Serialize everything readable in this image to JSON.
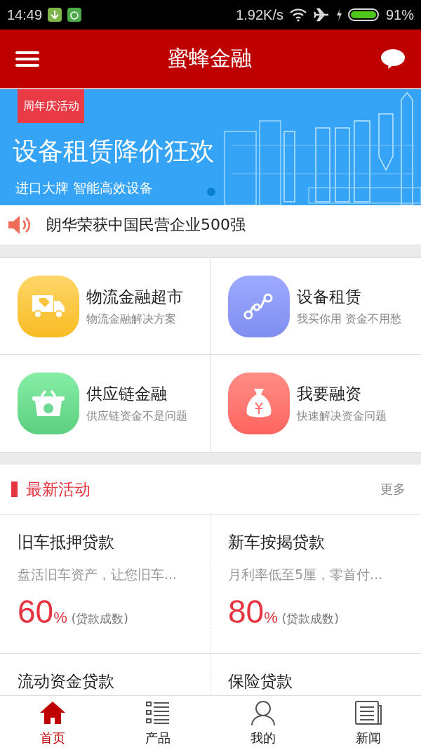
{
  "status_bar": {
    "time": "14:49",
    "speed": "1.92K/s",
    "battery": "91%"
  },
  "header": {
    "title": "蜜蜂金融"
  },
  "banner": {
    "tag": "周年庆活动",
    "headline": "设备租赁降价狂欢",
    "subline": "进口大牌 智能高效设备"
  },
  "notice": {
    "text": "朗华荣获中国民营企业500强"
  },
  "services": [
    {
      "kind": "truck",
      "title": "物流金融超市",
      "subtitle": "物流金融解决方案"
    },
    {
      "kind": "route",
      "title": "设备租赁",
      "subtitle": "我买你用 资金不用愁"
    },
    {
      "kind": "basket",
      "title": "供应链金融",
      "subtitle": "供应链资金不是问题"
    },
    {
      "kind": "moneybag",
      "title": "我要融资",
      "subtitle": "快速解决资金问题"
    }
  ],
  "activities": {
    "title": "最新活动",
    "more": "更多",
    "items": [
      {
        "title": "旧车抵押贷款",
        "desc": "盘活旧车资产，让您旧车...",
        "value": "60",
        "unit": "%",
        "note": "(贷款成数)"
      },
      {
        "title": "新车按揭贷款",
        "desc": "月利率低至5厘，零首付...",
        "value": "80",
        "unit": "%",
        "note": "(贷款成数)"
      },
      {
        "title": "流动资金贷款"
      },
      {
        "title": "保险贷款"
      }
    ]
  },
  "tabs": [
    {
      "kind": "home",
      "label": "首页",
      "selected": true
    },
    {
      "kind": "list",
      "label": "产品",
      "selected": false
    },
    {
      "kind": "person",
      "label": "我的",
      "selected": false
    },
    {
      "kind": "news",
      "label": "新闻",
      "selected": false
    }
  ]
}
